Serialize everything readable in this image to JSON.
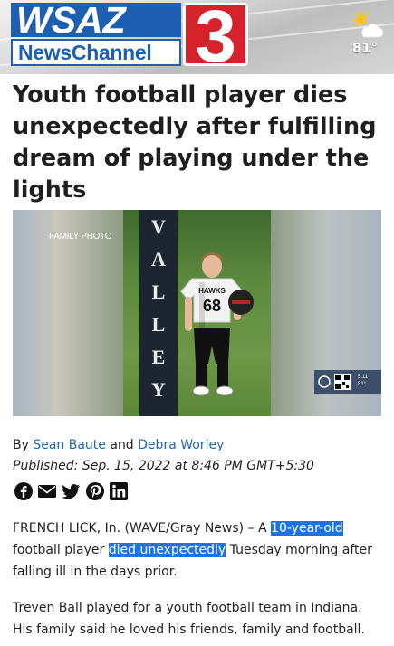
{
  "header": {
    "logo_top": "WSAZ",
    "logo_bottom": "NewsChannel",
    "logo_number": "3",
    "weather_icon": "partly-sunny-icon",
    "temperature": "81°"
  },
  "article": {
    "headline": "Youth football player dies unexpectedly after fulfilling dream of playing under the lights",
    "image": {
      "caption": "FAMILY PHOTO",
      "pole_letters": [
        "V",
        "A",
        "L",
        "L",
        "E",
        "Y"
      ],
      "jersey_text": "HAWKS",
      "jersey_number": "68",
      "bug_time": "5:11",
      "bug_temp": "81°"
    },
    "byline_prefix": "By",
    "author_1": "Sean Baute",
    "byline_and": "and",
    "author_2": "Debra Worley",
    "published": "Published: Sep. 15, 2022 at 8:46 PM GMT+5:30",
    "share_icons": [
      "facebook-icon",
      "email-icon",
      "twitter-icon",
      "pinterest-icon",
      "linkedin-icon"
    ],
    "p1_part1": "FRENCH LICK, In. (WAVE/Gray News) – A",
    "p1_highlight1": "10-year-old",
    "p1_part2": "football player",
    "p1_highlight2": "died unexpectedly",
    "p1_part3": "Tuesday morning after falling ill in the days prior.",
    "p2": "Treven Ball played for a youth football team in Indiana. His family said he loved his friends, family and football."
  },
  "colors": {
    "brand_blue": "#1d5fb0",
    "brand_red": "#d6232b",
    "link": "#2266aa",
    "selection": "#1a73e8"
  }
}
